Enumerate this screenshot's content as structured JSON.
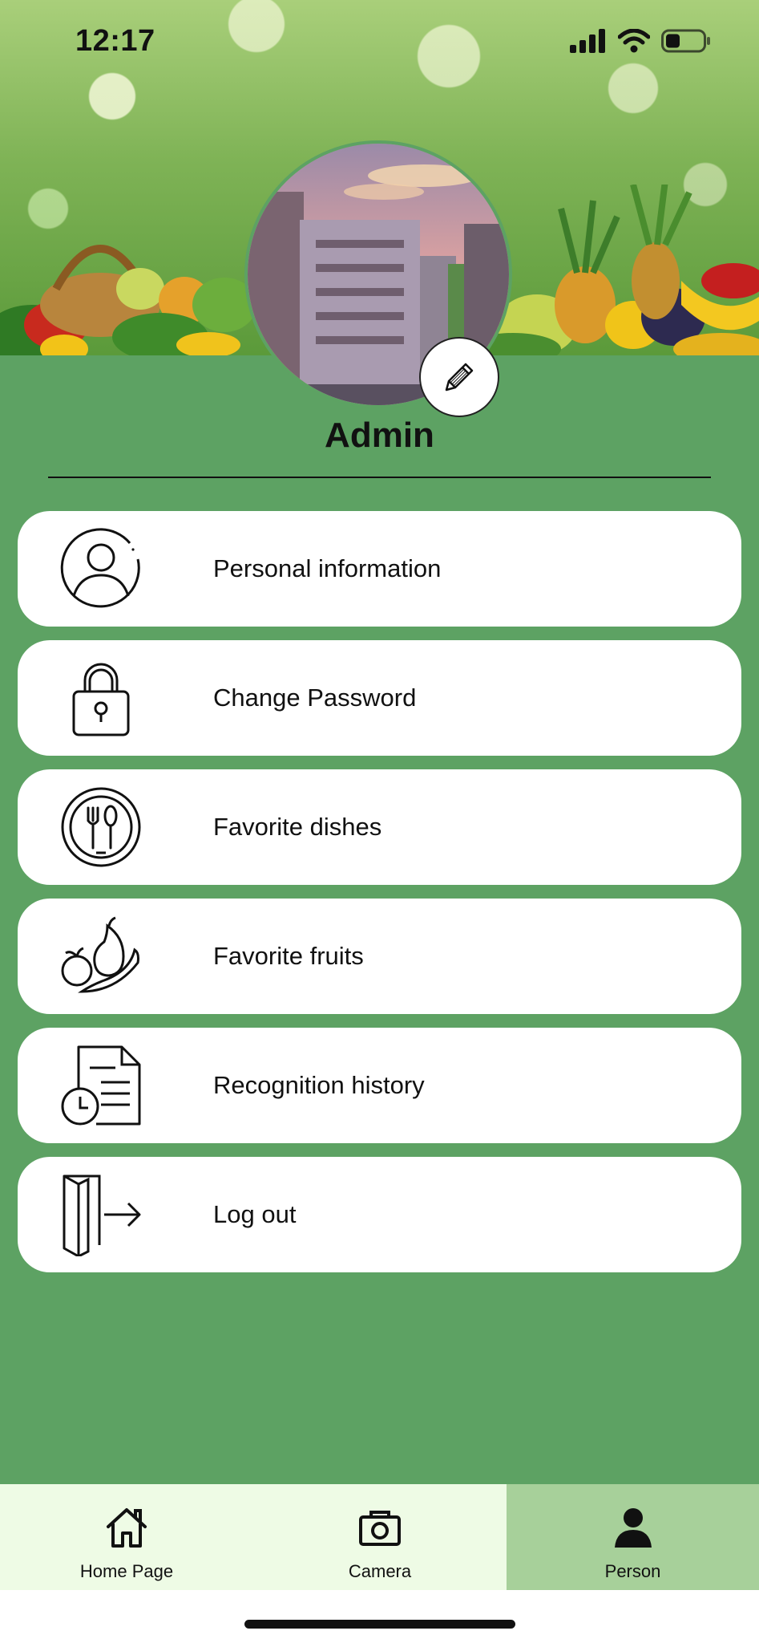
{
  "status_bar": {
    "time": "12:17"
  },
  "profile": {
    "name": "Admin"
  },
  "menu": {
    "items": [
      {
        "label": "Personal information",
        "icon": "user-circle-icon"
      },
      {
        "label": "Change Password",
        "icon": "padlock-icon"
      },
      {
        "label": "Favorite dishes",
        "icon": "plate-utensils-icon"
      },
      {
        "label": "Favorite fruits",
        "icon": "fruits-icon"
      },
      {
        "label": "Recognition history",
        "icon": "document-clock-icon"
      },
      {
        "label": "Log out",
        "icon": "door-exit-icon"
      }
    ]
  },
  "tabs": [
    {
      "label": "Home Page",
      "icon": "home-icon",
      "active": false
    },
    {
      "label": "Camera",
      "icon": "camera-icon",
      "active": false
    },
    {
      "label": "Person",
      "icon": "person-icon",
      "active": true
    }
  ],
  "colors": {
    "content_bg": "#5da263",
    "tab_bg": "#eefbe5",
    "tab_active_bg": "#a7d09a",
    "card_bg": "#ffffff"
  }
}
